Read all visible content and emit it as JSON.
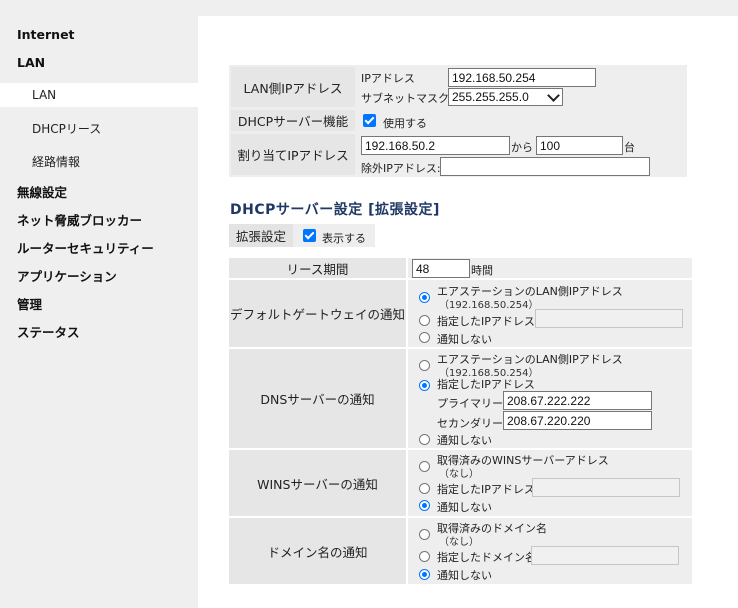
{
  "sidebar": {
    "items": [
      {
        "label": "Internet"
      },
      {
        "label": "LAN"
      },
      {
        "label": "LAN"
      },
      {
        "label": "DHCPリース"
      },
      {
        "label": "経路情報"
      },
      {
        "label": "無線設定"
      },
      {
        "label": "ネット脅威ブロッカー"
      },
      {
        "label": "ルーターセキュリティー"
      },
      {
        "label": "アプリケーション"
      },
      {
        "label": "管理"
      },
      {
        "label": "ステータス"
      }
    ]
  },
  "lan": {
    "ip_label": "LAN側IPアドレス",
    "ip_address_label": "IPアドレス",
    "ip_address_value": "192.168.50.254",
    "subnet_label": "サブネットマスク",
    "subnet_value": "255.255.255.0",
    "dhcp_label": "DHCPサーバー機能",
    "dhcp_use_label": "使用する",
    "assign_label": "割り当てIPアドレス",
    "assign_start": "192.168.50.2",
    "assign_from": "から",
    "assign_count": "100",
    "assign_unit": "台",
    "exclude_label": "除外IPアドレス:",
    "exclude_value": ""
  },
  "dhcp_ext": {
    "heading": "DHCPサーバー設定 [拡張設定]",
    "ext_label": "拡張設定",
    "show_label": "表示する",
    "lease_label": "リース期間",
    "lease_value": "48",
    "lease_unit": "時間",
    "gateway": {
      "label": "デフォルトゲートウェイの通知",
      "opt_station": "エアステーションのLAN側IPアドレス",
      "opt_station_sub": "（192.168.50.254）",
      "opt_specified": "指定したIPアドレス",
      "opt_none": "通知しない"
    },
    "dns": {
      "label": "DNSサーバーの通知",
      "opt_station": "エアステーションのLAN側IPアドレス",
      "opt_station_sub": "（192.168.50.254）",
      "opt_specified": "指定したIPアドレス",
      "primary_label": "プライマリー",
      "primary_value": "208.67.222.222",
      "secondary_label": "セカンダリー",
      "secondary_value": "208.67.220.220",
      "opt_none": "通知しない"
    },
    "wins": {
      "label": "WINSサーバーの通知",
      "opt_acquired": "取得済みのWINSサーバーアドレス",
      "opt_acquired_sub": "（なし）",
      "opt_specified": "指定したIPアドレス",
      "opt_none": "通知しない"
    },
    "domain": {
      "label": "ドメイン名の通知",
      "opt_acquired": "取得済みのドメイン名",
      "opt_acquired_sub": "（なし）",
      "opt_specified": "指定したドメイン名",
      "opt_none": "通知しない"
    }
  },
  "colors": {
    "accent": "#0075ff",
    "heading": "#1f3864",
    "label_bg": "#e6e6e6",
    "panel_bg": "#eeeeee"
  }
}
